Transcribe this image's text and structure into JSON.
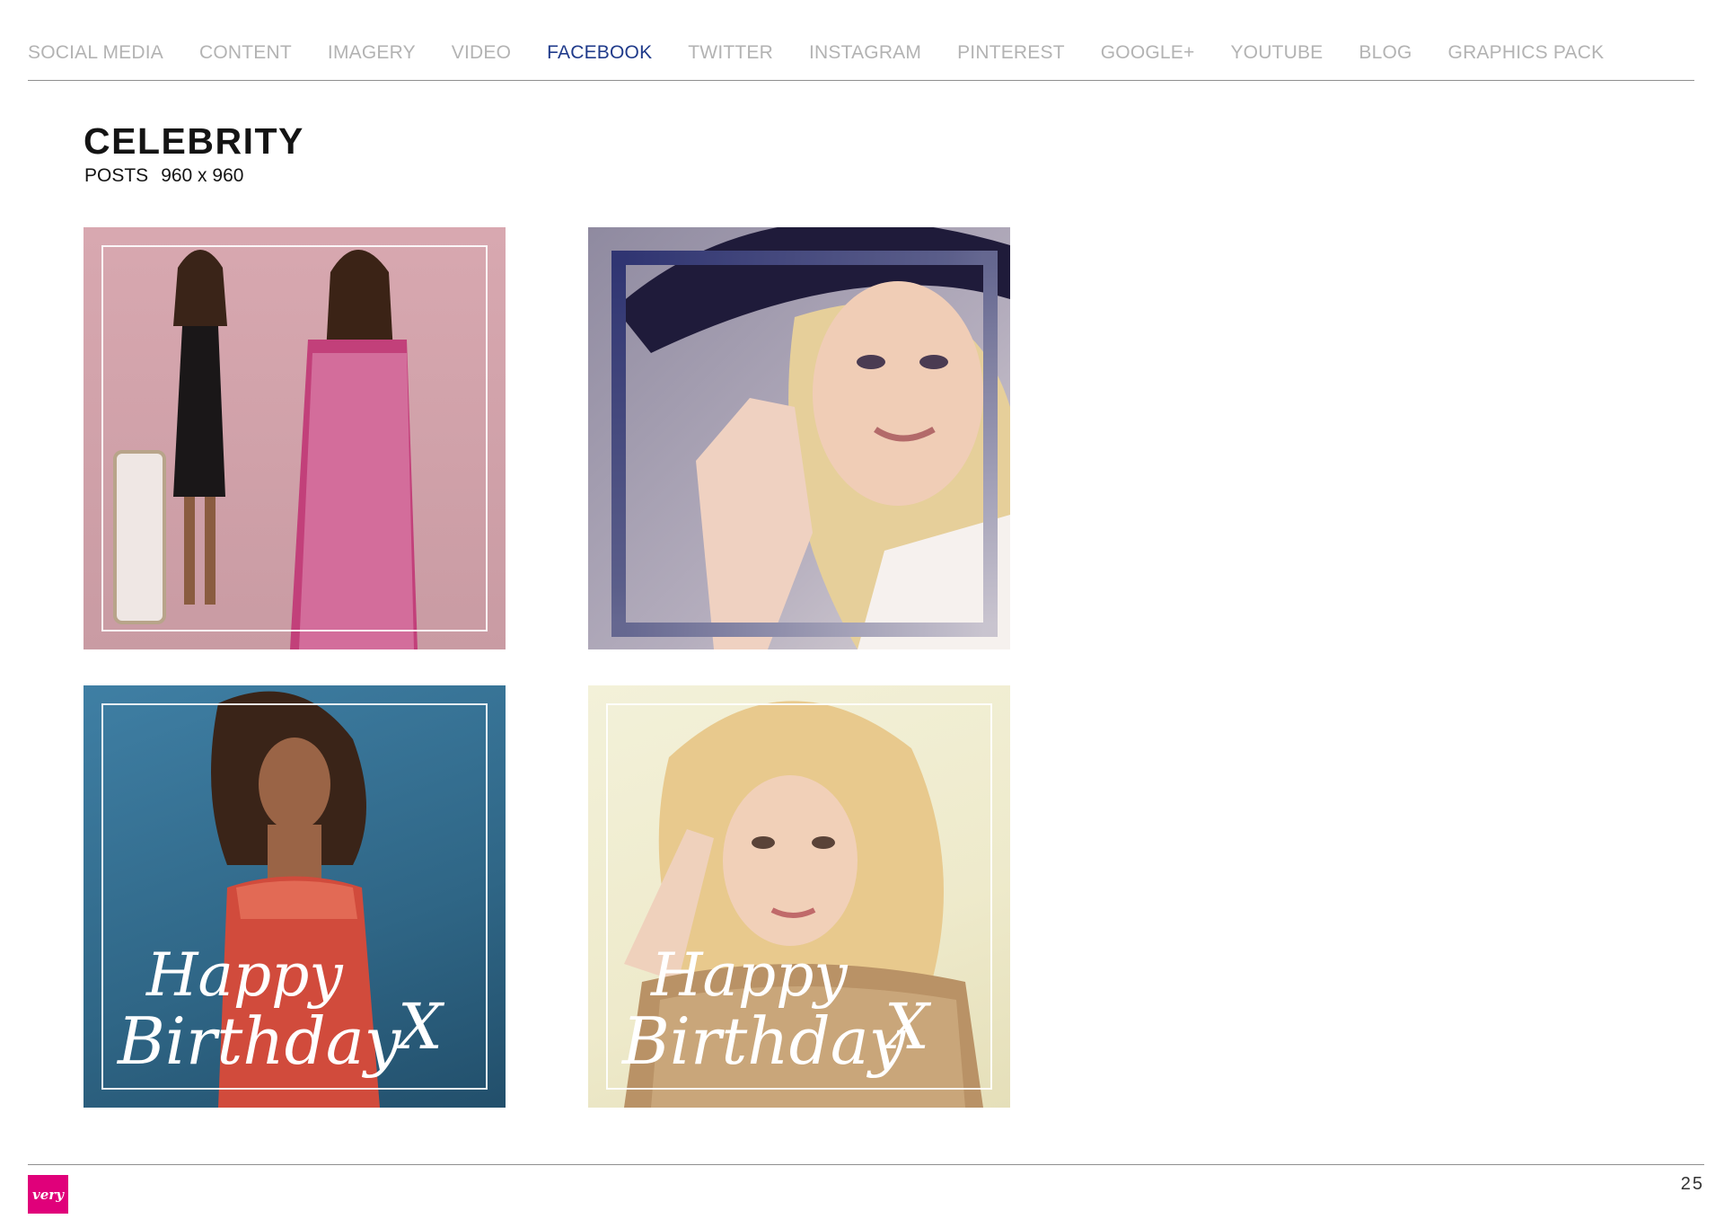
{
  "nav": {
    "items": [
      {
        "label": "SOCIAL MEDIA",
        "active": false
      },
      {
        "label": "CONTENT",
        "active": false
      },
      {
        "label": "IMAGERY",
        "active": false
      },
      {
        "label": "VIDEO",
        "active": false
      },
      {
        "label": "FACEBOOK",
        "active": true
      },
      {
        "label": "TWITTER",
        "active": false
      },
      {
        "label": "INSTAGRAM",
        "active": false
      },
      {
        "label": "PINTEREST",
        "active": false
      },
      {
        "label": "GOOGLE+",
        "active": false
      },
      {
        "label": "YOUTUBE",
        "active": false
      },
      {
        "label": "BLOG",
        "active": false
      },
      {
        "label": "GRAPHICS PACK",
        "active": false
      }
    ],
    "active_color": "#1f3a8a",
    "inactive_color": "#b3b3b3"
  },
  "section": {
    "title": "CELEBRITY",
    "subtitle_label": "POSTS",
    "subtitle_size": "960 x 960"
  },
  "tiles": [
    {
      "caption_line1": "",
      "caption_line2": "",
      "caption_mark": ""
    },
    {
      "caption_line1": "",
      "caption_line2": "",
      "caption_mark": ""
    },
    {
      "caption_line1": "Happy",
      "caption_line2": "Birthday",
      "caption_mark": "X"
    },
    {
      "caption_line1": "Happy",
      "caption_line2": "Birthday",
      "caption_mark": "X"
    }
  ],
  "footer": {
    "logo_text": "very",
    "logo_color": "#e0007a",
    "page_number": "25"
  }
}
